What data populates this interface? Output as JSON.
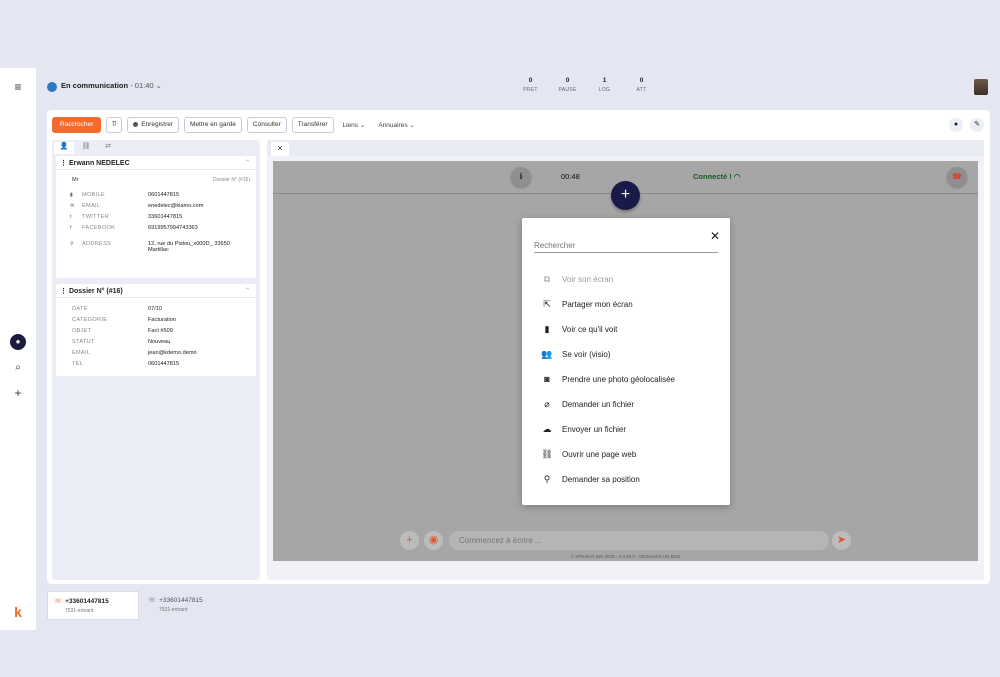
{
  "nav": {
    "menu_icon": "≡",
    "chat_icon": "●",
    "search_icon": "⌕",
    "add_icon": "+",
    "logo": "k"
  },
  "status": {
    "label": "En communication",
    "timer": "01:40",
    "dot_color": "#2f79c0"
  },
  "counters": [
    {
      "num": "0",
      "label": "PRET"
    },
    {
      "num": "0",
      "label": "PAUSE"
    },
    {
      "num": "1",
      "label": "LOG"
    },
    {
      "num": "0",
      "label": "ATT"
    }
  ],
  "toolbar": {
    "hangup": "Raccrocher",
    "record": "Enregistrer",
    "hold": "Mettre en garde",
    "consult": "Consulter",
    "transfer": "Transférer",
    "links": "Liens",
    "directories": "Annuaires"
  },
  "contact": {
    "name": "Erwann NEDELEC",
    "title": "Mr",
    "dossier_ref": "Dossier N° (#16)",
    "fields": [
      {
        "key": "MOBILE",
        "icon": "▮",
        "value": "0601447815"
      },
      {
        "key": "EMAIL",
        "icon": "✉",
        "value": "enedelec@kiamo.com"
      },
      {
        "key": "TWITTER",
        "icon": "t",
        "value": "33601447815"
      },
      {
        "key": "FACEBOOK",
        "icon": "f",
        "value": "6919957994743363"
      },
      {
        "key": "ADDRESS",
        "icon": "⚲",
        "value": "12, rue du Pistou_x000D_ 33650 Martillac"
      }
    ]
  },
  "dossier": {
    "title": "Dossier N° (#16)",
    "fields": [
      {
        "key": "DATE",
        "value": "07/10"
      },
      {
        "key": "CATÉGORIE",
        "value": "Facturation"
      },
      {
        "key": "OBJET",
        "value": "Fact #509"
      },
      {
        "key": "STATUT",
        "value": "Nouveau"
      },
      {
        "key": "EMAIL",
        "value": "jean@kdemo.demo"
      },
      {
        "key": "TEL",
        "value": "0601447815"
      }
    ]
  },
  "session": {
    "time": "00:48",
    "connected": "Connecté !",
    "chat_placeholder": "Commencez à écrire ...",
    "footer": "© SPEAKYLINK 2023 - V.3.29.0 - SIGNALER UN BUG"
  },
  "modal": {
    "search_placeholder": "Rechercher",
    "items": [
      {
        "label": "Voir son écran",
        "icon": "⧉",
        "disabled": true
      },
      {
        "label": "Partager mon écran",
        "icon": "⇱",
        "disabled": false
      },
      {
        "label": "Voir ce qu'il voit",
        "icon": "▮",
        "disabled": false
      },
      {
        "label": "Se voir (visio)",
        "icon": "👥",
        "disabled": false
      },
      {
        "label": "Prendre une photo géolocalisée",
        "icon": "◙",
        "disabled": false
      },
      {
        "label": "Demander un fichier",
        "icon": "⌀",
        "disabled": false
      },
      {
        "label": "Envoyer un fichier",
        "icon": "☁",
        "disabled": false
      },
      {
        "label": "Ouvrir une page web",
        "icon": "⛓",
        "disabled": false
      },
      {
        "label": "Demander sa position",
        "icon": "⚲",
        "disabled": false
      }
    ]
  },
  "calls": [
    {
      "number": "+33601447815",
      "sub": "7531-entrant",
      "active": true
    },
    {
      "number": "+33601447815",
      "sub": "7531-entrant",
      "active": false
    }
  ]
}
